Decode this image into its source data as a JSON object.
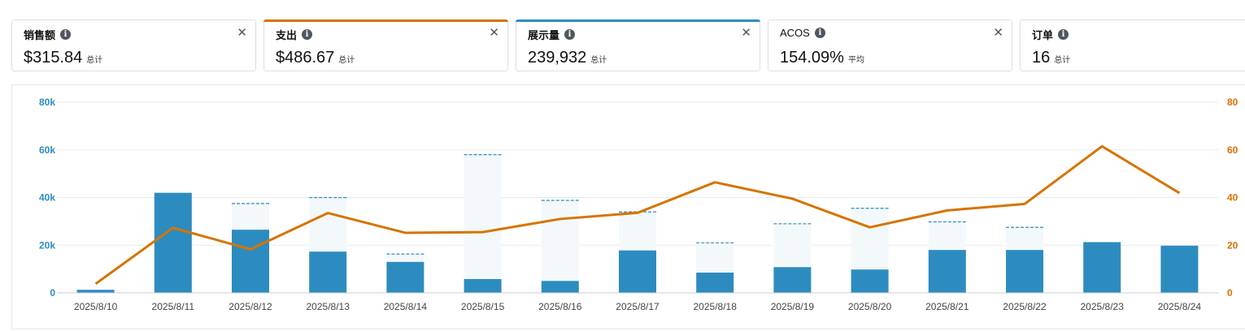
{
  "metric_cards": [
    {
      "label": "销售额",
      "value": "$315.84",
      "suffix": "总计",
      "accent": null,
      "selected": false
    },
    {
      "label": "支出",
      "value": "$486.67",
      "suffix": "总计",
      "accent": "#d67400",
      "selected": true
    },
    {
      "label": "展示量",
      "value": "239,932",
      "suffix": "总计",
      "accent": "#2d8cbf",
      "selected": true
    },
    {
      "label": "ACOS",
      "value": "154.09%",
      "suffix": "平均",
      "accent": null,
      "selected": false
    },
    {
      "label": "订单",
      "value": "16",
      "suffix": "总计",
      "accent": null,
      "selected": false
    }
  ],
  "icons": {
    "info": "info-icon",
    "close": "close-icon"
  },
  "glyphs": {
    "info": "i",
    "close": "✕"
  },
  "colors": {
    "impressions": "#2d8cbf",
    "spend": "#d67400",
    "ghost_fill": "#f3f8fb",
    "ghost_dash": "#2d8cbf",
    "grid": "#e8eaec"
  },
  "chart_data": {
    "type": "bar",
    "categories": [
      "2025/8/10",
      "2025/8/11",
      "2025/8/12",
      "2025/8/13",
      "2025/8/14",
      "2025/8/15",
      "2025/8/16",
      "2025/8/17",
      "2025/8/18",
      "2025/8/19",
      "2025/8/20",
      "2025/8/21",
      "2025/8/22",
      "2025/8/23",
      "2025/8/24"
    ],
    "y_left": {
      "ticks": [
        "0",
        "20k",
        "40k",
        "60k",
        "80k"
      ],
      "range": [
        0,
        80000
      ]
    },
    "y_right": {
      "ticks": [
        "0",
        "20",
        "40",
        "60",
        "80"
      ],
      "range": [
        0,
        80
      ]
    },
    "grid": true,
    "series": [
      {
        "type": "bar",
        "axis": "left",
        "values": [
          1300,
          42000,
          26500,
          17300,
          13000,
          5800,
          5000,
          17800,
          8500,
          10800,
          9800,
          18000,
          18000,
          21300,
          19800
        ]
      },
      {
        "type": "bar-comparison",
        "axis": "left",
        "values": [
          null,
          null,
          37500,
          40000,
          16300,
          58000,
          38800,
          34000,
          21000,
          29000,
          35500,
          29800,
          27500,
          null,
          null
        ]
      },
      {
        "type": "line",
        "axis": "right",
        "values": [
          3.8,
          27.3,
          18.3,
          33.5,
          25.2,
          25.5,
          31.0,
          33.6,
          46.4,
          39.5,
          27.5,
          34.6,
          37.3,
          61.5,
          41.9
        ]
      }
    ]
  }
}
